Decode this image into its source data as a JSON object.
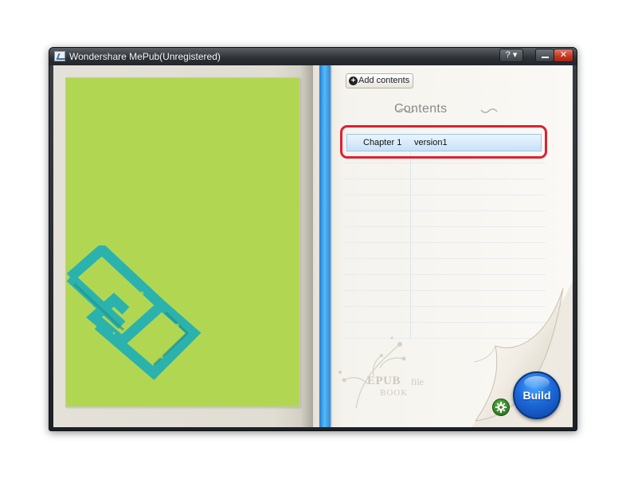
{
  "window": {
    "title": "Wondershare MePub(Unregistered)",
    "help_label": "? ▾",
    "close_label": "✕"
  },
  "toolbar": {
    "add_contents_label": "Add contents"
  },
  "contents": {
    "heading": "Contents",
    "rows": [
      {
        "chapter": "Chapter 1",
        "title": "version1"
      }
    ]
  },
  "watermark": {
    "epub": "EPUB",
    "file": "file",
    "book": "BOOK"
  },
  "actions": {
    "build_label": "Build"
  },
  "colors": {
    "cover": "#b1d752",
    "logo": "#2bb2ad",
    "ribbon": "#2a8de0",
    "highlight": "#e02030",
    "build": "#1b68d8",
    "settings": "#2f7d21"
  },
  "icons": {
    "app": "app-icon",
    "add": "plus-circle-icon",
    "settings": "gear-icon",
    "minimize": "minimize-icon",
    "close": "close-icon"
  }
}
